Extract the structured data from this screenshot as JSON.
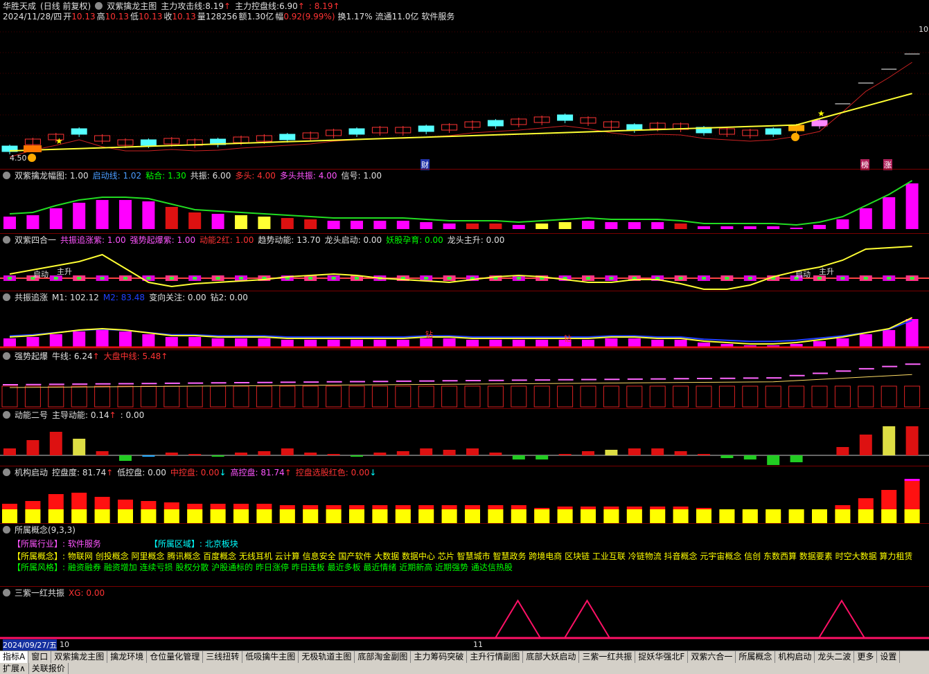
{
  "main": {
    "stock": "华胜天成",
    "period": "(日线 前复权)",
    "indicator": "双紫擒龙主图",
    "attack_label": "主力攻击线:",
    "attack_val": "8.19",
    "control_label": "主力控盘线:",
    "control_val": "6.90",
    "third_val": ": 8.19",
    "info": {
      "date": "2024/11/28/四",
      "open_l": "开",
      "open": "10.13",
      "high_l": "高",
      "high": "10.13",
      "low_l": "低",
      "low": "10.13",
      "close_l": "收",
      "close": "10.13",
      "vol_l": "量",
      "vol": "128256",
      "amt_l": "额",
      "amt": "1.30亿",
      "chg_l": "幅",
      "chg": "0.92(9.99%)",
      "turn": "换1.17%",
      "float": "流通11.0亿",
      "sector": "软件服务"
    },
    "price_low": "4.50",
    "price_high": "10",
    "cai": "财",
    "bang": "榜",
    "zhang": "涨"
  },
  "panels": {
    "p1": {
      "name": "双紫擒龙幅图",
      "v0": ": 1.00",
      "a": "启动线: 1.02",
      "b": "粘合: 1.30",
      "c": "共振: 6.00",
      "d": "多头: 4.00",
      "e": "多头共振: 4.00",
      "f": "信号: 1.00"
    },
    "p2": {
      "name": "双紫四合一",
      "a": "共振追涨紫: 1.00",
      "b": "强势起爆紫: 1.00",
      "c": "动能2红: 1.00",
      "d": "趋势动能: 13.70",
      "e": "龙头启动: 0.00",
      "f": "妖股孕育: 0.00",
      "g": "龙头主升: 0.00",
      "l1": "启动",
      "l2": "主升",
      "l3": "启动",
      "l4": "主升"
    },
    "p3": {
      "name": "共振追涨",
      "a": "M1: 102.12",
      "b": "M2: 83.48",
      "c": "变向关注: 0.00",
      "d": "钻2: 0.00",
      "z1": "钻",
      "z2": "钻"
    },
    "p4": {
      "name": "强势起爆",
      "a": "牛线: 6.24",
      "b": "大盘中线: 5.48"
    },
    "p5": {
      "name": "动能二号",
      "a": "主导动能: 0.14",
      "b": ": 0.00"
    },
    "p6": {
      "name": "机构启动",
      "a": "控盘度: 81.74",
      "b": "低控盘: 0.00",
      "c": "中控盘: 0.00",
      "d": "高控盘: 81.74",
      "e": "控盘选股红色: 0.00"
    },
    "p7": {
      "name": "所属概念(9,3,3)",
      "ind_l": "【所属行业】:",
      "ind": "软件服务",
      "reg_l": "【所属区域】:",
      "reg": "北京板块",
      "con_l": "【所属概念】:",
      "con": "物联网 创投概念 阿里概念 腾讯概念 百度概念 无线耳机 云计算 信息安全 国产软件 大数据 数据中心 芯片 智慧城市 智慧政务 跨境电商 区块链 工业互联 冷链物流 抖音概念 元宇宙概念 信创 东数西算 数据要素 时空大数据 算力租赁",
      "sty_l": "【所属风格】:",
      "sty": "融资融券 融资增加 连续亏损 股权分散 沪股通标的 昨日涨停 昨日连板 最近多板 最近情绪 近期新高 近期强势 通达信热股"
    },
    "p8": {
      "name": "三紫一红共振",
      "a": "XG: 0.00",
      "date": "2024/09/27/五",
      "m1": "10",
      "m2": "11"
    }
  },
  "tabs": [
    "指标A",
    "窗口",
    "双紫擒龙主图",
    "擒龙环境",
    "仓位量化管理",
    "三线扭转",
    "低吸擒牛主图",
    "无极轨道主图",
    "底部淘金副图",
    "主力筹码突破",
    "主升行情副图",
    "底部大妖启动",
    "三紫一红共振",
    "捉妖华强北F",
    "双紫六合一",
    "所属概念",
    "机构启动",
    "龙头二波",
    "更多",
    "设置"
  ],
  "status": [
    "扩展∧",
    "关联报价"
  ]
}
